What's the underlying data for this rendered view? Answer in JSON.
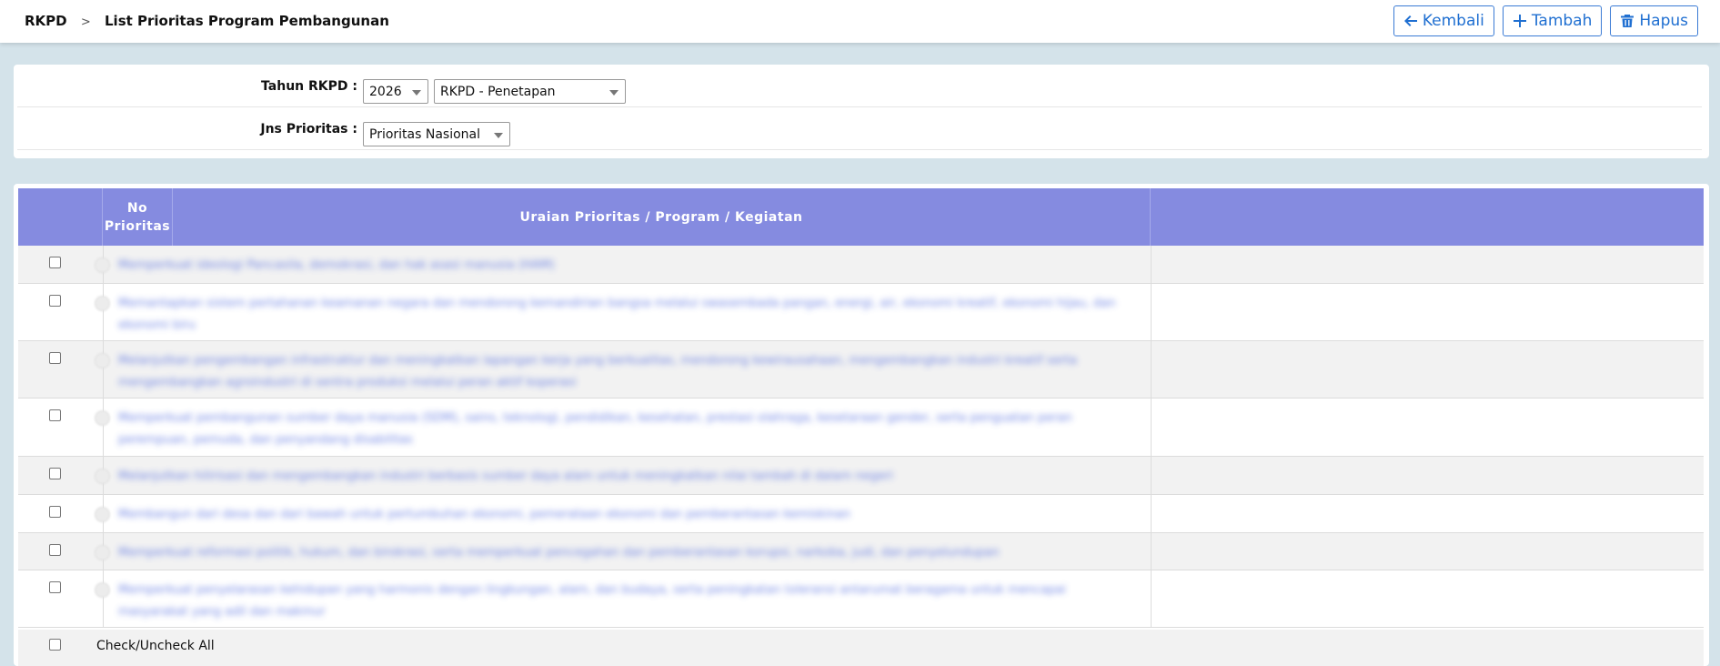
{
  "breadcrumb": {
    "root": "RKPD",
    "separator": ">",
    "current": "List Prioritas Program Pembangunan"
  },
  "actions": {
    "back_label": "Kembali",
    "add_label": "Tambah",
    "delete_label": "Hapus"
  },
  "filters": {
    "tahun_label": "Tahun RKPD :",
    "tahun_value": "2026",
    "tahapan_value": "RKPD - Penetapan",
    "jenis_label": "Jns Prioritas :",
    "jenis_value": "Prioritas Nasional"
  },
  "table": {
    "headers": {
      "no": "No\nPrioritas",
      "uraian": "Uraian Prioritas / Program / Kegiatan",
      "extra": ""
    },
    "rows": [
      {
        "text": "Memperkuat ideologi Pancasila, demokrasi, dan hak asasi manusia (HAM)"
      },
      {
        "text": "Memantapkan sistem pertahanan keamanan negara dan mendorong kemandirian bangsa melalui swasembada pangan, energi, air, ekonomi kreatif, ekonomi hijau, dan ekonomi biru"
      },
      {
        "text": "Melanjutkan pengembangan infrastruktur dan meningkatkan lapangan kerja yang berkualitas, mendorong kewirausahaan, mengembangkan industri kreatif serta mengembangkan agroindustri di sentra produksi melalui peran aktif koperasi"
      },
      {
        "text": "Memperkuat pembangunan sumber daya manusia (SDM), sains, teknologi, pendidikan, kesehatan, prestasi olahraga, kesetaraan gender, serta penguatan peran perempuan, pemuda, dan penyandang disabilitas"
      },
      {
        "text": "Melanjutkan hilirisasi dan mengembangkan industri berbasis sumber daya alam untuk meningkatkan nilai tambah di dalam negeri"
      },
      {
        "text": "Membangun dari desa dan dari bawah untuk pertumbuhan ekonomi, pemerataan ekonomi dan pemberantasan kemiskinan"
      },
      {
        "text": "Memperkuat reformasi politik, hukum, dan birokrasi, serta memperkuat pencegahan dan pemberantasan korupsi, narkoba, judi, dan penyelundupan"
      },
      {
        "text": "Memperkuat penyelarasan kehidupan yang harmonis dengan lingkungan, alam, dan budaya, serta peningkatan toleransi antarumat beragama untuk mencapai masyarakat yang adil dan makmur"
      }
    ],
    "check_all_label": "Check/Uncheck All"
  },
  "colors": {
    "header_bg": "#858be0",
    "accent": "#1f6fd1",
    "page_bg": "#d4e3ea"
  },
  "icons": [
    "arrow-left-icon",
    "plus-icon",
    "trash-icon"
  ]
}
